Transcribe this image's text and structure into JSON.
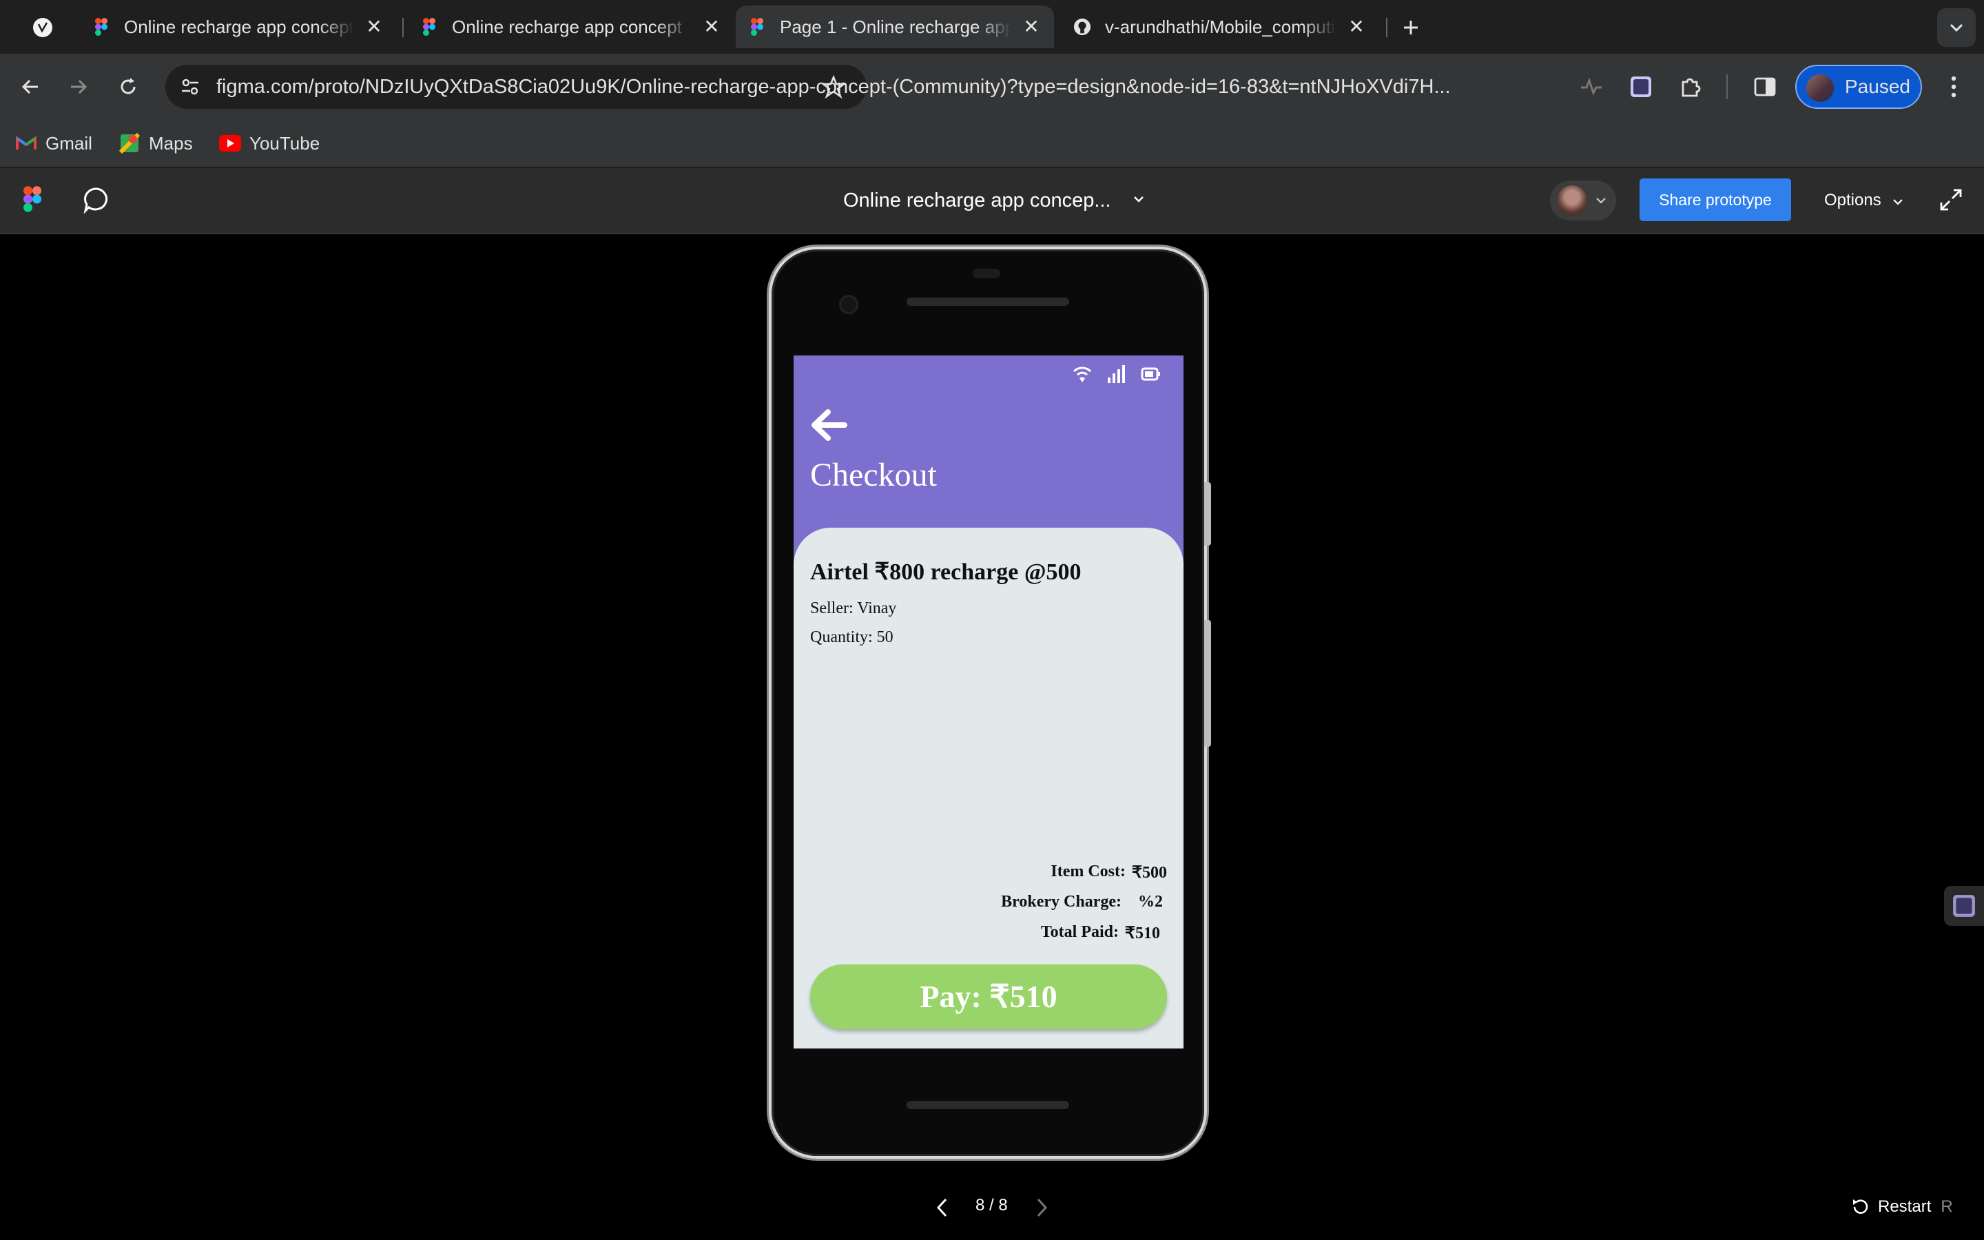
{
  "browser": {
    "tabs": [
      {
        "title": "Online recharge app concept",
        "active": false
      },
      {
        "title": "Online recharge app concept",
        "active": false
      },
      {
        "title": "Page 1 - Online recharge app",
        "active": true
      },
      {
        "title": "v-arundhathi/Mobile_computing",
        "active": false
      }
    ],
    "url": "figma.com/proto/NDzIUyQXtDaS8Cia02Uu9K/Online-recharge-app-concept-(Community)?type=design&node-id=16-83&t=ntNJHoXVdi7H...",
    "profile_label": "Paused",
    "bookmarks": [
      {
        "label": "Gmail",
        "icon": "gmail-icon"
      },
      {
        "label": "Maps",
        "icon": "maps-icon"
      },
      {
        "label": "YouTube",
        "icon": "youtube-icon"
      }
    ]
  },
  "figma": {
    "title": "Online recharge app concep...",
    "share_label": "Share prototype",
    "options_label": "Options",
    "pager": "8 / 8",
    "restart_label": "Restart",
    "restart_shortcut": "R"
  },
  "app": {
    "title": "Checkout",
    "product": "Airtel ₹800 recharge @500",
    "seller": "Seller: Vinay",
    "quantity": "Quantity: 50",
    "summary": [
      {
        "label": "Item Cost:",
        "value": "₹500"
      },
      {
        "label": "Brokery Charge:",
        "value": "%2"
      },
      {
        "label": "Total Paid:",
        "value": "₹510"
      }
    ],
    "pay_label": "Pay: ₹510",
    "colors": {
      "header": "#7d6fcd",
      "sheet": "#e1e9ea",
      "pay": "#99d46b",
      "share": "#2f80ed"
    }
  }
}
